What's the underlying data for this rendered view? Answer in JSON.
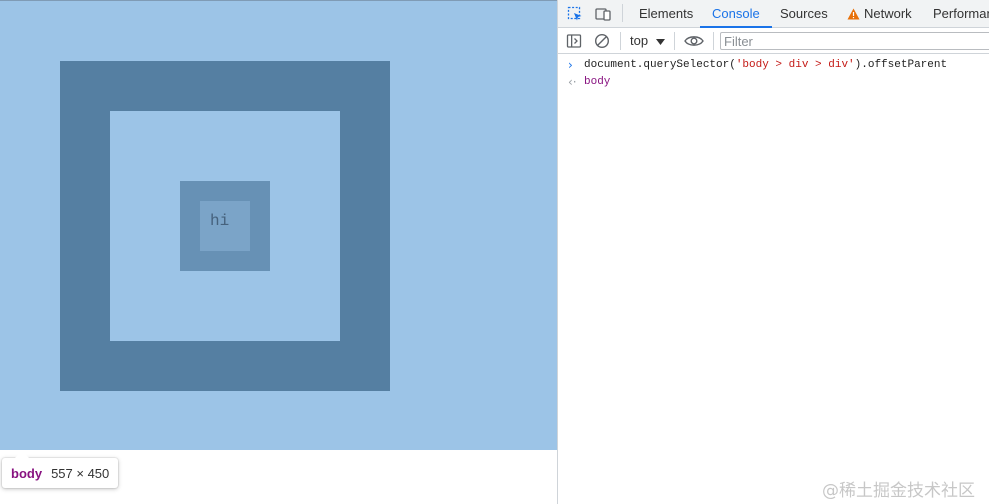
{
  "preview": {
    "hi_text": "hi",
    "tooltip": {
      "tag": "body",
      "size": "557 × 450"
    },
    "colors": {
      "body_highlight": "#9cc4e7",
      "outer": "#557fa2",
      "middle": "#9cc4e7",
      "inner": "#6791b5",
      "inner_content": "#7ba4c8"
    }
  },
  "devtools": {
    "tabs": [
      "Elements",
      "Console",
      "Sources",
      "Network",
      "Performan"
    ],
    "active_tab": "Console",
    "network_warning_icon": "warning-triangle-icon",
    "toolbar": {
      "context": "top",
      "filter_placeholder": "Filter"
    },
    "console": {
      "input_prefix": "document.querySelector(",
      "input_string": "'body > div > div'",
      "input_suffix": ").offsetParent",
      "result": "body"
    },
    "accent_color": "#1a73e8"
  },
  "watermark": "@稀土掘金技术社区"
}
